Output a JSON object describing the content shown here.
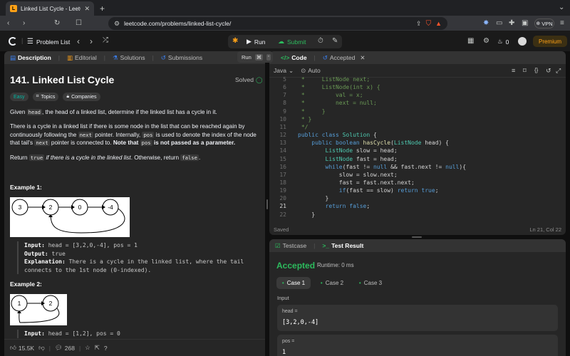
{
  "browser": {
    "tab_title": "Linked List Cycle - LeetCode",
    "url": "leetcode.com/problems/linked-list-cycle/",
    "vpn_label": "VPN"
  },
  "nav": {
    "problem_list": "Problem List",
    "run": "Run",
    "submit": "Submit",
    "fire_count": "0",
    "premium": "Premium"
  },
  "desc_tabs": [
    "Description",
    "Editorial",
    "Solutions",
    "Submissions"
  ],
  "problem": {
    "title": "141. Linked List Cycle",
    "status": "Solved",
    "difficulty": "Easy",
    "topics": "Topics",
    "companies": "Companies",
    "p1": [
      "Given ",
      "head",
      ", the head of a linked list, determine if the linked list has a cycle in it."
    ],
    "p2": [
      "There is a cycle in a linked list if there is some node in the list that can be reached again by continuously following the ",
      "next",
      " pointer. Internally, ",
      "pos",
      " is used to denote the index of the node that tail's ",
      "next",
      " pointer is connected to. ",
      "Note that ",
      "pos",
      " is not passed as a parameter."
    ],
    "p3": [
      "Return ",
      "true",
      " if there is a cycle in the linked list",
      ". Otherwise, return ",
      "false",
      "."
    ],
    "ex1_title": "Example 1:",
    "ex1_nodes": [
      "3",
      "2",
      "0",
      "-4"
    ],
    "ex1_input_label": "Input:",
    "ex1_input": " head = [3,2,0,-4], pos = 1",
    "ex1_output_label": "Output:",
    "ex1_output": " true",
    "ex1_expl_label": "Explanation:",
    "ex1_expl1": " There is a cycle in the linked list, where the tail",
    "ex1_expl2": "connects to the 1st node (0-indexed).",
    "ex2_title": "Example 2:",
    "ex2_nodes": [
      "1",
      "2"
    ],
    "ex2_input_label": "Input:",
    "ex2_input": " head = [1,2], pos = 0"
  },
  "footer": {
    "likes": "15.5K",
    "comments": "268"
  },
  "popup": {
    "run": "Run",
    "cmd": "⌘",
    "quote": "'"
  },
  "code_tabs": {
    "code": "Code",
    "accepted": "Accepted"
  },
  "editor": {
    "language": "Java",
    "auto": "Auto",
    "saved": "Saved",
    "cursor": "Ln 21, Col 22",
    "lines": [
      {
        "n": "5",
        "t": " *     ListNode next;",
        "cls": "cm"
      },
      {
        "n": "6",
        "t": " *     ListNode(int x) {",
        "cls": "cm"
      },
      {
        "n": "7",
        "t": " *         val = x;",
        "cls": "cm"
      },
      {
        "n": "8",
        "t": " *         next = null;",
        "cls": "cm"
      },
      {
        "n": "9",
        "t": " *     }",
        "cls": "cm"
      },
      {
        "n": "10",
        "t": " * }",
        "cls": "cm"
      },
      {
        "n": "11",
        "t": " */",
        "cls": "cm"
      },
      {
        "n": "12",
        "t": "public class Solution {",
        "cls": "mix"
      },
      {
        "n": "13",
        "t": "    public boolean hasCycle(ListNode head) {",
        "cls": "mix"
      },
      {
        "n": "14",
        "t": "        ListNode slow = head;",
        "cls": "mix"
      },
      {
        "n": "15",
        "t": "        ListNode fast = head;",
        "cls": "mix"
      },
      {
        "n": "16",
        "t": "        while(fast != null && fast.next != null){",
        "cls": "mix"
      },
      {
        "n": "17",
        "t": "            slow = slow.next;",
        "cls": "mix"
      },
      {
        "n": "18",
        "t": "            fast = fast.next.next;",
        "cls": "mix"
      },
      {
        "n": "19",
        "t": "            if(fast == slow) return true;",
        "cls": "mix"
      },
      {
        "n": "20",
        "t": "        }",
        "cls": "pl"
      },
      {
        "n": "21",
        "t": "        return false;",
        "cls": "mix"
      },
      {
        "n": "22",
        "t": "    }",
        "cls": "pl"
      }
    ]
  },
  "result": {
    "tab_testcase": "Testcase",
    "tab_result": "Test Result",
    "status": "Accepted",
    "runtime": "Runtime: 0 ms",
    "cases": [
      "Case 1",
      "Case 2",
      "Case 3"
    ],
    "input_label": "Input",
    "head_label": "head =",
    "head_value": "[3,2,0,-4]",
    "pos_label": "pos =",
    "pos_value": "1"
  },
  "colors": {
    "accent": "#ffa116",
    "green": "#2cbb5d",
    "bg": "#0f0f0f",
    "panel": "#262626"
  }
}
